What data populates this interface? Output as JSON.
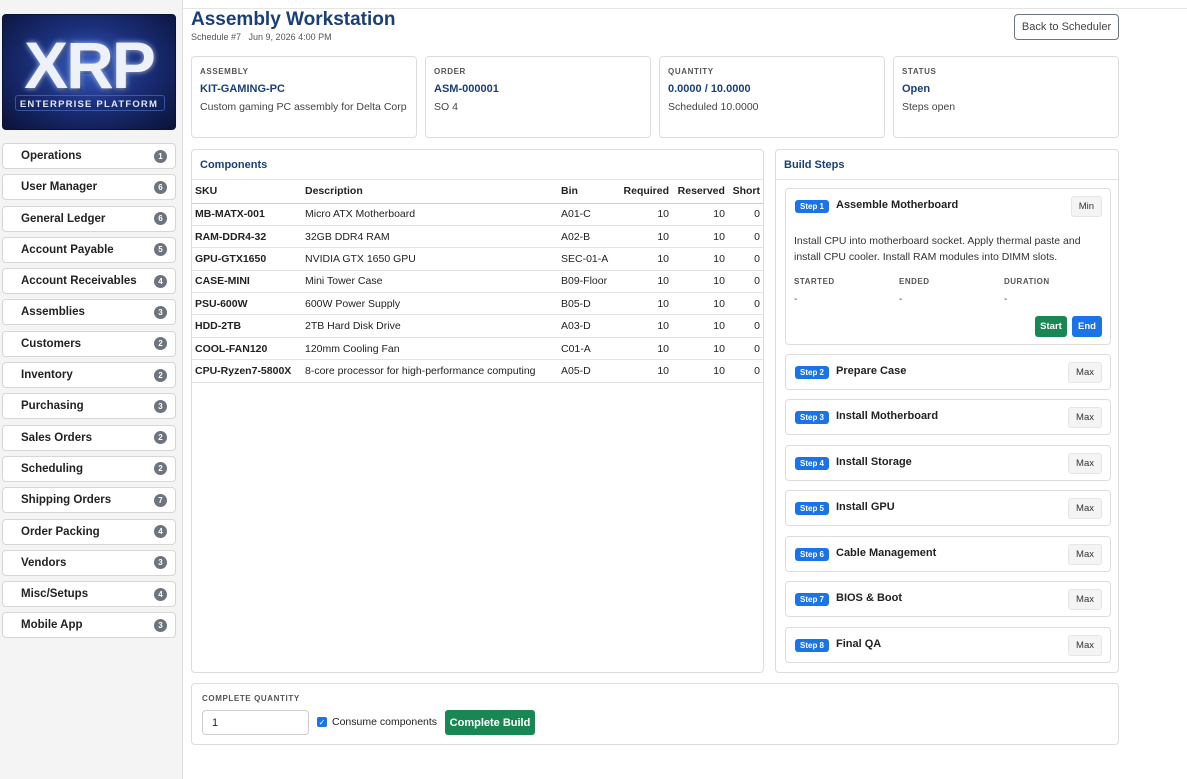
{
  "logo": {
    "text": "XRP",
    "subtext": "ENTERPRISE PLATFORM"
  },
  "sidebar": {
    "items": [
      {
        "label": "Operations",
        "count": "1"
      },
      {
        "label": "User Manager",
        "count": "6"
      },
      {
        "label": "General Ledger",
        "count": "6"
      },
      {
        "label": "Account Payable",
        "count": "5"
      },
      {
        "label": "Account Receivables",
        "count": "4"
      },
      {
        "label": "Assemblies",
        "count": "3"
      },
      {
        "label": "Customers",
        "count": "2"
      },
      {
        "label": "Inventory",
        "count": "2"
      },
      {
        "label": "Purchasing",
        "count": "3"
      },
      {
        "label": "Sales Orders",
        "count": "2"
      },
      {
        "label": "Scheduling",
        "count": "2"
      },
      {
        "label": "Shipping Orders",
        "count": "7"
      },
      {
        "label": "Order Packing",
        "count": "4"
      },
      {
        "label": "Vendors",
        "count": "3"
      },
      {
        "label": "Misc/Setups",
        "count": "4"
      },
      {
        "label": "Mobile App",
        "count": "3"
      }
    ]
  },
  "header": {
    "title": "Assembly Workstation",
    "subtitle": "Schedule #7   Jun 9, 2026 4:00 PM",
    "back_label": "Back to Scheduler"
  },
  "info": {
    "assembly": {
      "caption": "ASSEMBLY",
      "value": "KIT-GAMING-PC",
      "desc": "Custom gaming PC assembly for Delta Corp"
    },
    "order": {
      "caption": "ORDER",
      "value": "ASM-000001",
      "desc": "SO 4"
    },
    "quantity": {
      "caption": "QUANTITY",
      "value": "0.0000 / 10.0000",
      "desc": "Scheduled 10.0000"
    },
    "status": {
      "caption": "STATUS",
      "value": "Open",
      "desc": "Steps open"
    }
  },
  "components": {
    "title": "Components",
    "headers": {
      "sku": "SKU",
      "description": "Description",
      "bin": "Bin",
      "required": "Required",
      "reserved": "Reserved",
      "short": "Short"
    },
    "rows": [
      {
        "sku": "MB-MATX-001",
        "description": "Micro ATX Motherboard",
        "bin": "A01-C",
        "required": "10",
        "reserved": "10",
        "short": "0"
      },
      {
        "sku": "RAM-DDR4-32",
        "description": "32GB DDR4 RAM",
        "bin": "A02-B",
        "required": "10",
        "reserved": "10",
        "short": "0"
      },
      {
        "sku": "GPU-GTX1650",
        "description": "NVIDIA GTX 1650 GPU",
        "bin": "SEC-01-A",
        "required": "10",
        "reserved": "10",
        "short": "0"
      },
      {
        "sku": "CASE-MINI",
        "description": "Mini Tower Case",
        "bin": "B09-Floor",
        "required": "10",
        "reserved": "10",
        "short": "0"
      },
      {
        "sku": "PSU-600W",
        "description": "600W Power Supply",
        "bin": "B05-D",
        "required": "10",
        "reserved": "10",
        "short": "0"
      },
      {
        "sku": "HDD-2TB",
        "description": "2TB Hard Disk Drive",
        "bin": "A03-D",
        "required": "10",
        "reserved": "10",
        "short": "0"
      },
      {
        "sku": "COOL-FAN120",
        "description": "120mm Cooling Fan",
        "bin": "C01-A",
        "required": "10",
        "reserved": "10",
        "short": "0"
      },
      {
        "sku": "CPU-Ryzen7-5800X",
        "description": "8-core processor for high-performance computing",
        "bin": "A05-D",
        "required": "10",
        "reserved": "10",
        "short": "0"
      }
    ]
  },
  "build_steps": {
    "title": "Build Steps",
    "steps": [
      {
        "badge": "Step 1",
        "title": "Assemble Motherboard",
        "toggle": "Min"
      },
      {
        "badge": "Step 2",
        "title": "Prepare Case",
        "toggle": "Max"
      },
      {
        "badge": "Step 3",
        "title": "Install Motherboard",
        "toggle": "Max"
      },
      {
        "badge": "Step 4",
        "title": "Install Storage",
        "toggle": "Max"
      },
      {
        "badge": "Step 5",
        "title": "Install GPU",
        "toggle": "Max"
      },
      {
        "badge": "Step 6",
        "title": "Cable Management",
        "toggle": "Max"
      },
      {
        "badge": "Step 7",
        "title": "BIOS & Boot",
        "toggle": "Max"
      },
      {
        "badge": "Step 8",
        "title": "Final QA",
        "toggle": "Max"
      }
    ],
    "expanded": {
      "instructions": "Install CPU into motherboard socket. Apply thermal paste and install CPU cooler. Install RAM modules into DIMM slots.",
      "started_label": "STARTED",
      "started_value": "-",
      "ended_label": "ENDED",
      "ended_value": "-",
      "duration_label": "DURATION",
      "duration_value": "-",
      "start_label": "Start",
      "end_label": "End"
    }
  },
  "complete": {
    "caption": "COMPLETE QUANTITY",
    "quantity": "1",
    "consume_label": "Consume components",
    "consume_checked": true,
    "button_label": "Complete Build"
  },
  "colors": {
    "title": "#1a3f78",
    "badge": "#1a73e8",
    "start": "#198754",
    "end": "#1a73e8",
    "complete": "#198754"
  }
}
